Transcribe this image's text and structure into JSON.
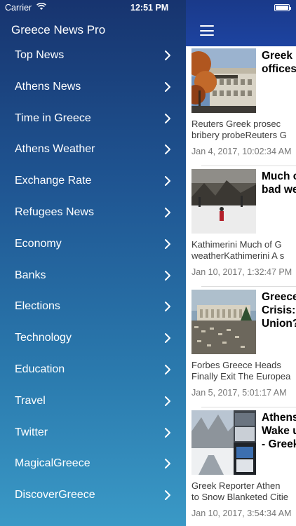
{
  "status_bar": {
    "carrier": "Carrier",
    "time": "12:51 PM",
    "wifi_icon": "wifi-icon",
    "battery_icon": "battery-icon"
  },
  "menu": {
    "title": "Greece News Pro",
    "items": [
      {
        "label": "Top News"
      },
      {
        "label": "Athens News"
      },
      {
        "label": "Time in Greece"
      },
      {
        "label": "Athens Weather"
      },
      {
        "label": "Exchange Rate"
      },
      {
        "label": "Refugees News"
      },
      {
        "label": "Economy"
      },
      {
        "label": "Banks"
      },
      {
        "label": "Elections"
      },
      {
        "label": "Technology"
      },
      {
        "label": "Education"
      },
      {
        "label": "Travel"
      },
      {
        "label": "Twitter"
      },
      {
        "label": "MagicalGreece"
      },
      {
        "label": "DiscoverGreece"
      }
    ],
    "chevron_icon": "chevron-right-icon"
  },
  "main": {
    "menu_icon": "hamburger-menu-icon",
    "articles": [
      {
        "headline_1": "Greek p",
        "headline_2": "offices",
        "headline_3": "",
        "desc_1": "Reuters   Greek prosec",
        "desc_2": "bribery probeReuters  G",
        "date": "Jan 4, 2017, 10:02:34 AM"
      },
      {
        "headline_1": "Much o",
        "headline_2": "bad we",
        "headline_3": "",
        "desc_1": "Kathimerini   Much of G",
        "desc_2": "weatherKathimerini  A s",
        "date": "Jan 10, 2017, 1:32:47 PM"
      },
      {
        "headline_1": "Greece",
        "headline_2": "Crisis:",
        "headline_3": "Union?",
        "desc_1": "Forbes   Greece Heads",
        "desc_2": "Finally Exit The Europea",
        "date": "Jan 5, 2017, 5:01:17 AM"
      },
      {
        "headline_1": "Athens",
        "headline_2": "Wake u",
        "headline_3": "- Greek",
        "desc_1": "Greek Reporter   Athen",
        "desc_2": "to Snow Blanketed Citie",
        "date": "Jan 10, 2017, 3:54:34 AM"
      }
    ]
  }
}
